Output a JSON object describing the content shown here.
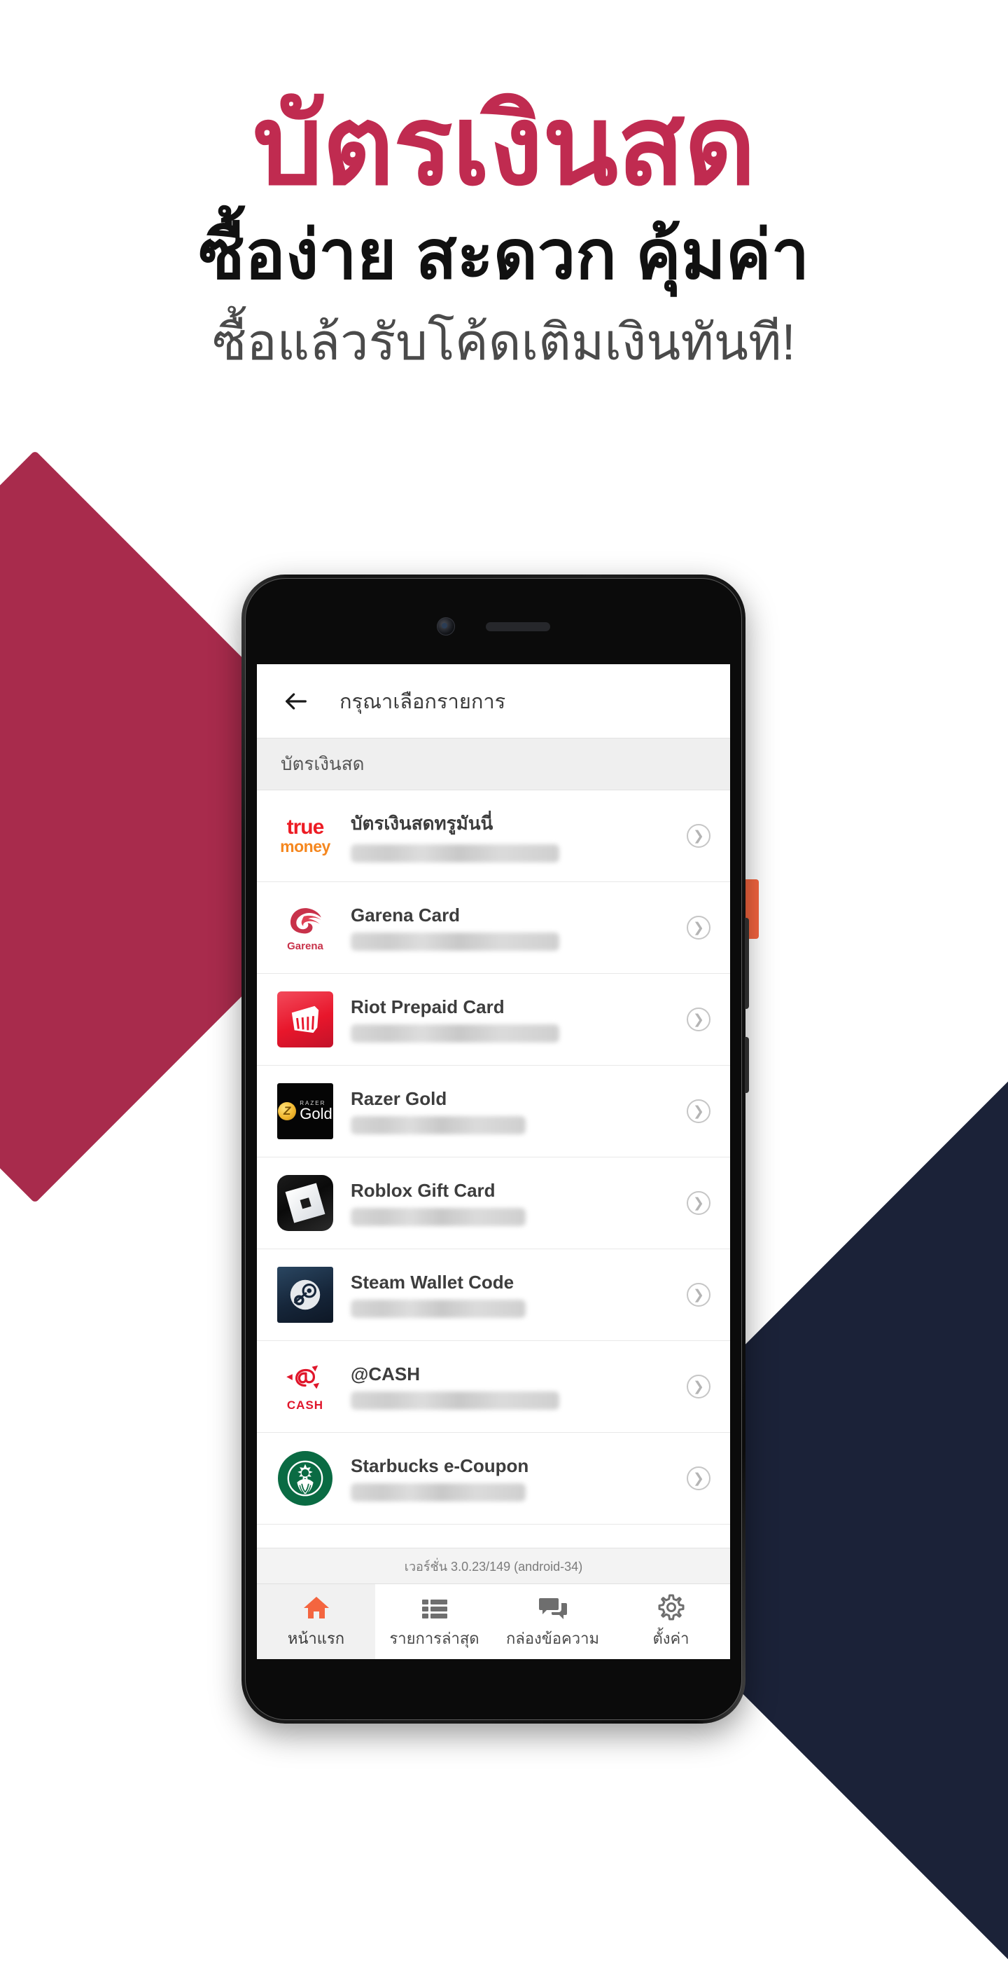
{
  "promo": {
    "line1": "บัตรเงินสด",
    "line2": "ซื้อง่าย สะดวก คุ้มค่า",
    "line3": "ซื้อแล้วรับโค้ดเติมเงินทันที!",
    "colors": {
      "line1": "#C02B50",
      "line2": "#111111",
      "line3": "#4A4A4A",
      "shape_left": "#A82B4C",
      "shape_right": "#1B2238",
      "accent_orange": "#F4653F"
    }
  },
  "app": {
    "appbar": {
      "back_icon": "arrow-left-icon",
      "title": "กรุณาเลือกรายการ"
    },
    "section_header": "บัตรเงินสด",
    "items": [
      {
        "title": "บัตรเงินสดทรูมันนี่",
        "logo": "truemoney-logo",
        "chevron": "chevron-right-icon",
        "subtitle_width": "mid"
      },
      {
        "title": "Garena Card",
        "logo": "garena-logo",
        "chevron": "chevron-right-icon",
        "subtitle_width": "mid"
      },
      {
        "title": "Riot Prepaid Card",
        "logo": "riot-logo",
        "chevron": "chevron-right-icon",
        "subtitle_width": "mid"
      },
      {
        "title": "Razer Gold",
        "logo": "razer-gold-logo",
        "chevron": "chevron-right-icon",
        "subtitle_width": "short"
      },
      {
        "title": "Roblox Gift Card",
        "logo": "roblox-logo",
        "chevron": "chevron-right-icon",
        "subtitle_width": "short"
      },
      {
        "title": "Steam Wallet Code",
        "logo": "steam-logo",
        "chevron": "chevron-right-icon",
        "subtitle_width": "short"
      },
      {
        "title": "@CASH",
        "logo": "atcash-logo",
        "chevron": "chevron-right-icon",
        "subtitle_width": "mid"
      },
      {
        "title": "Starbucks e-Coupon",
        "logo": "starbucks-logo",
        "chevron": "chevron-right-icon",
        "subtitle_width": "short"
      }
    ],
    "version": "เวอร์ชั่น 3.0.23/149 (android-34)",
    "bottom_nav": [
      {
        "label": "หน้าแรก",
        "icon": "home-icon",
        "active": true
      },
      {
        "label": "รายการล่าสุด",
        "icon": "list-icon",
        "active": false
      },
      {
        "label": "กล่องข้อความ",
        "icon": "messages-icon",
        "active": false
      },
      {
        "label": "ตั้งค่า",
        "icon": "gear-icon",
        "active": false
      }
    ],
    "nav_active_color": "#F4653F",
    "nav_inactive_color": "#6E6E6E"
  },
  "razer_logo": {
    "small": "RAZER",
    "word": "Gold",
    "coin": "Z"
  },
  "truemoney_logo": {
    "top": "true",
    "bottom": "money"
  },
  "garena_logo": {
    "word": "Garena"
  },
  "atcash_logo": {
    "word": "CASH"
  }
}
